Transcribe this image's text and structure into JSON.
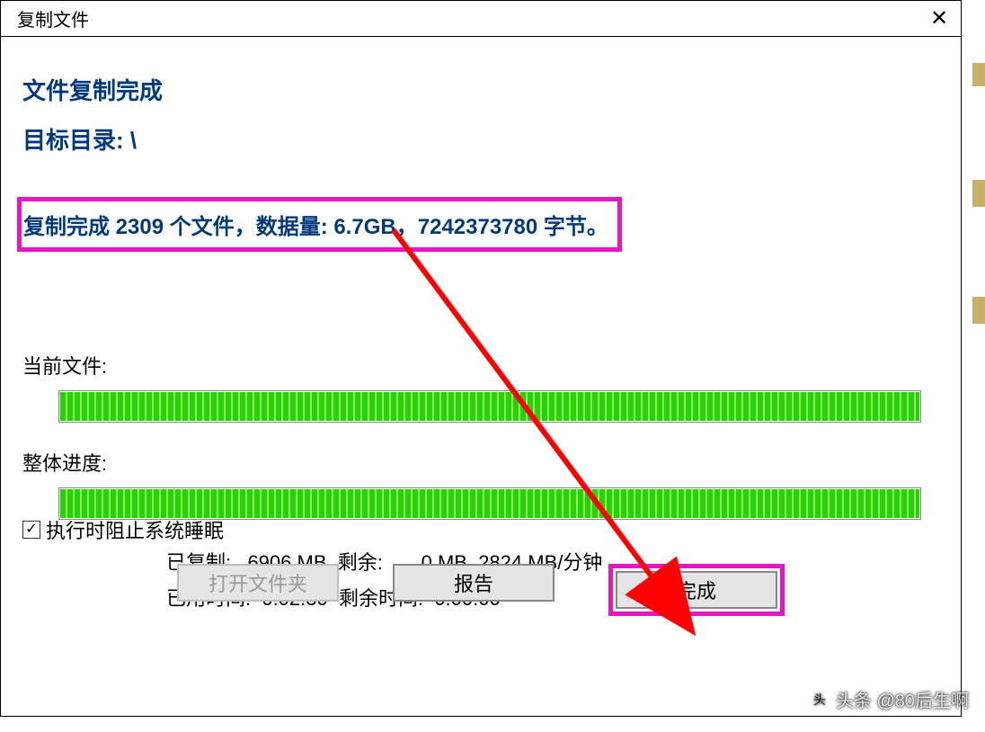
{
  "titlebar": {
    "title": "复制文件",
    "close_label": "✕"
  },
  "headline": {
    "complete": "文件复制完成",
    "target_dir_label": "目标目录: \\"
  },
  "summary": {
    "text": "复制完成 2309 个文件，数据量: 6.7GB，7242373780 字节。"
  },
  "progress": {
    "current_file_label": "当前文件:",
    "overall_label": "整体进度:"
  },
  "stats": {
    "line1": "已复制:   6906 MB  剩余:       0 MB  2824 MB/分钟",
    "line2": "已用时间:  0:02:30  剩余时间:  0:00:00"
  },
  "checkbox": {
    "label": "执行时阻止系统睡眠",
    "checked_glyph": "✓"
  },
  "buttons": {
    "open_folder": "打开文件夹",
    "report": "报告",
    "finish": "完成"
  },
  "watermark": {
    "text": "头条 @80后生啊"
  }
}
